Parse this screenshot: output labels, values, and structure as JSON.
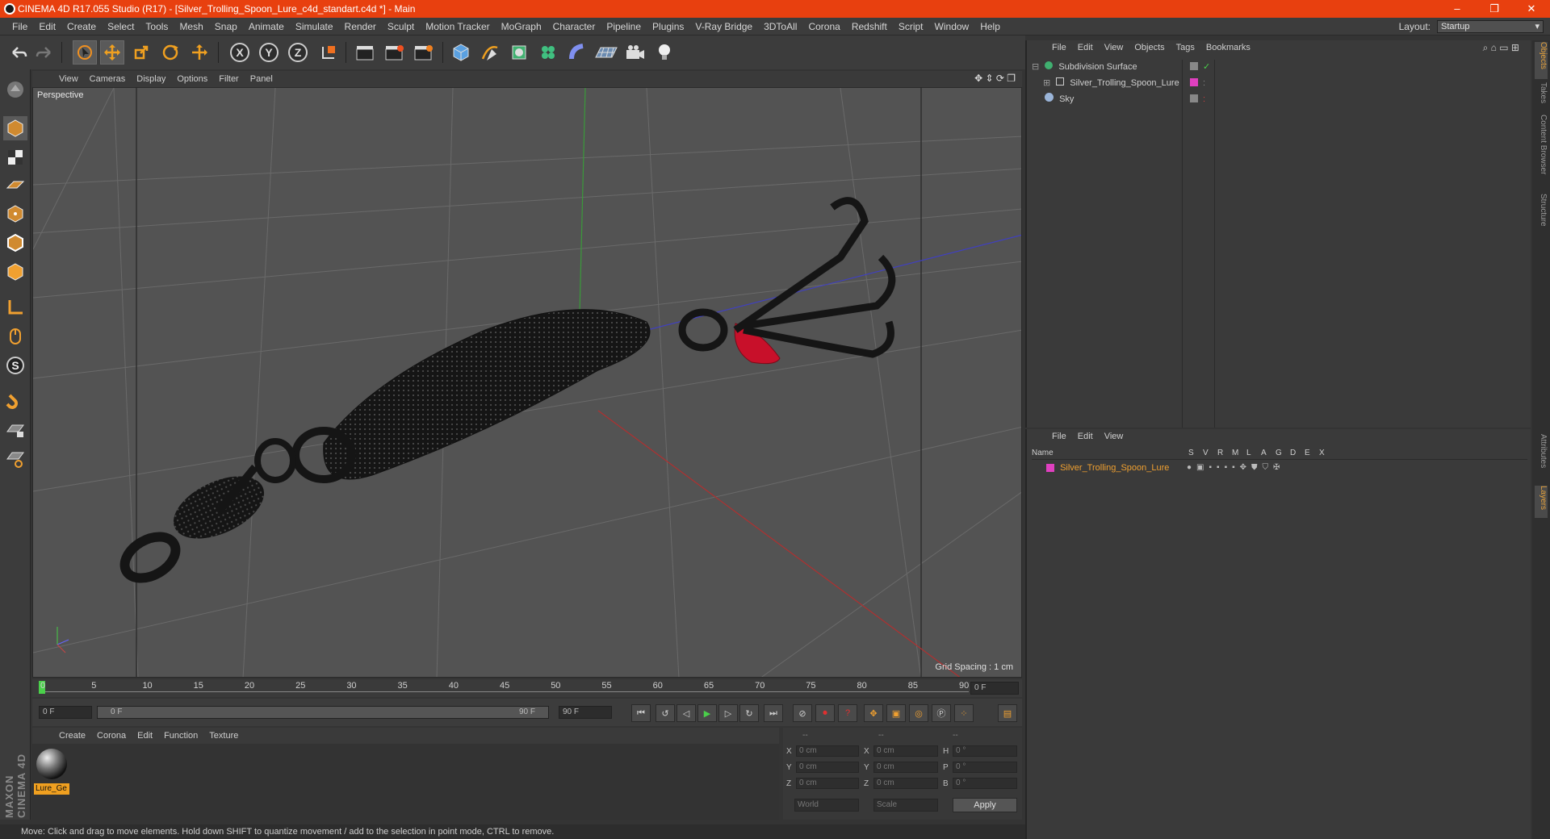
{
  "window": {
    "title": "CINEMA 4D R17.055 Studio (R17) - [Silver_Trolling_Spoon_Lure_c4d_standart.c4d *] - Main",
    "controls": [
      "–",
      "❐",
      "✕"
    ]
  },
  "menu": [
    "File",
    "Edit",
    "Create",
    "Select",
    "Tools",
    "Mesh",
    "Snap",
    "Animate",
    "Simulate",
    "Render",
    "Sculpt",
    "Motion Tracker",
    "MoGraph",
    "Character",
    "Pipeline",
    "Plugins",
    "V-Ray Bridge",
    "3DToAll",
    "Corona",
    "Redshift",
    "Script",
    "Window",
    "Help"
  ],
  "layout": {
    "label": "Layout:",
    "value": "Startup"
  },
  "toolbar": {
    "axes": [
      "X",
      "Y",
      "Z"
    ]
  },
  "viewport": {
    "menu": [
      "View",
      "Cameras",
      "Display",
      "Options",
      "Filter",
      "Panel"
    ],
    "label": "Perspective",
    "grid_spacing": "Grid Spacing : 1 cm"
  },
  "timeline": {
    "ticks": [
      "0",
      "5",
      "10",
      "15",
      "20",
      "25",
      "30",
      "35",
      "40",
      "45",
      "50",
      "55",
      "60",
      "65",
      "70",
      "75",
      "80",
      "85",
      "90"
    ],
    "current_frame": "0 F"
  },
  "transport": {
    "start": "0 F",
    "range_start": "0 F",
    "range_end": "90 F",
    "end": "90 F"
  },
  "material_manager": {
    "menu": [
      "Create",
      "Corona",
      "Edit",
      "Function",
      "Texture"
    ],
    "materials": [
      {
        "name": "Lure_Ge"
      }
    ]
  },
  "coordinates": {
    "header": [
      "--",
      "--",
      "--"
    ],
    "rows": [
      {
        "a": "X",
        "av": "0 cm",
        "b": "X",
        "bv": "0 cm",
        "c": "H",
        "cv": "0 °"
      },
      {
        "a": "Y",
        "av": "0 cm",
        "b": "Y",
        "bv": "0 cm",
        "c": "P",
        "cv": "0 °"
      },
      {
        "a": "Z",
        "av": "0 cm",
        "b": "Z",
        "bv": "0 cm",
        "c": "B",
        "cv": "0 °"
      }
    ],
    "mode1": "World",
    "mode2": "Scale",
    "apply": "Apply"
  },
  "status": "Move: Click and drag to move elements. Hold down SHIFT to quantize movement / add to the selection in point mode, CTRL to remove.",
  "object_manager": {
    "menu": [
      "File",
      "Edit",
      "View",
      "Objects",
      "Tags",
      "Bookmarks"
    ],
    "objects": [
      {
        "name": "Subdivision Surface",
        "level": 0
      },
      {
        "name": "Silver_Trolling_Spoon_Lure",
        "level": 1
      },
      {
        "name": "Sky",
        "level": 0
      }
    ]
  },
  "layer_manager": {
    "menu": [
      "File",
      "Edit",
      "View"
    ],
    "columns": [
      "Name",
      "S",
      "V",
      "R",
      "M",
      "L",
      "A",
      "G",
      "D",
      "E",
      "X"
    ],
    "layers": [
      {
        "name": "Silver_Trolling_Spoon_Lure",
        "color": "#e040c0"
      }
    ]
  },
  "side_tabs": [
    "Objects",
    "Takes",
    "Content Browser",
    "Structure",
    "Attributes",
    "Layers"
  ],
  "brand": "MAXON CINEMA 4D",
  "colors": {
    "accent": "#e8400f",
    "highlight": "#f0a030",
    "layer": "#e040c0"
  }
}
